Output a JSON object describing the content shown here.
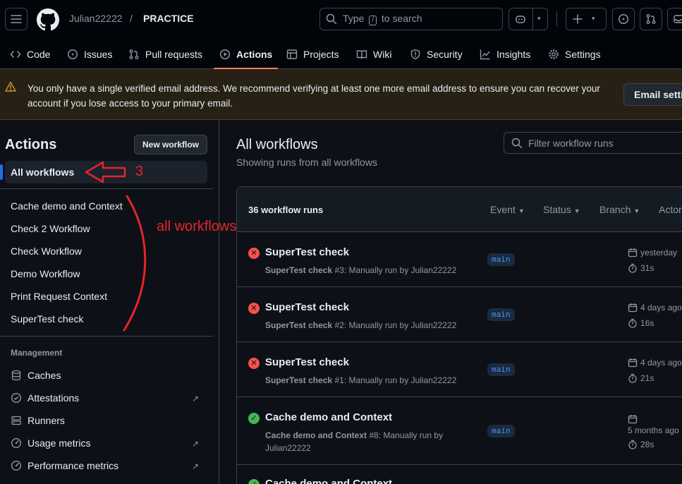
{
  "header": {
    "owner": "Julian22222",
    "separator": "/",
    "repo": "PRACTICE",
    "search_placeholder_before": "Type",
    "search_key": "/",
    "search_placeholder_after": "to search"
  },
  "tabs": [
    {
      "label": "Code",
      "icon": "code-icon"
    },
    {
      "label": "Issues",
      "icon": "issue-icon"
    },
    {
      "label": "Pull requests",
      "icon": "pull-request-icon"
    },
    {
      "label": "Actions",
      "icon": "play-icon",
      "active": true
    },
    {
      "label": "Projects",
      "icon": "table-icon"
    },
    {
      "label": "Wiki",
      "icon": "book-icon"
    },
    {
      "label": "Security",
      "icon": "shield-icon"
    },
    {
      "label": "Insights",
      "icon": "graph-icon"
    },
    {
      "label": "Settings",
      "icon": "gear-icon"
    }
  ],
  "banner": {
    "text": "You only have a single verified email address. We recommend verifying at least one more email address to ensure you can recover your account if you lose access to your primary email.",
    "button": "Email settings"
  },
  "sidebar": {
    "title": "Actions",
    "new_workflow": "New workflow",
    "active": "All workflows",
    "workflows": [
      "Cache demo and Context",
      "Check 2 Workflow",
      "Check Workflow",
      "Demo Workflow",
      "Print Request Context",
      "SuperTest check"
    ],
    "management_heading": "Management",
    "management": [
      {
        "label": "Caches",
        "icon": "database-icon"
      },
      {
        "label": "Attestations",
        "icon": "verified-icon",
        "external": true
      },
      {
        "label": "Runners",
        "icon": "server-icon"
      },
      {
        "label": "Usage metrics",
        "icon": "meter-icon",
        "external": true
      },
      {
        "label": "Performance metrics",
        "icon": "meter-icon",
        "external": true
      }
    ]
  },
  "main": {
    "title": "All workflows",
    "subtitle": "Showing runs from all workflows",
    "filter_placeholder": "Filter workflow runs",
    "runs_count": "36 workflow runs",
    "filters": [
      "Event",
      "Status",
      "Branch",
      "Actor"
    ],
    "runs": [
      {
        "status": "failure",
        "title": "SuperTest check",
        "workflow": "SuperTest check",
        "detail": " #3: Manually run by Julian22222",
        "branch": "main",
        "date": "yesterday",
        "duration": "31s"
      },
      {
        "status": "failure",
        "title": "SuperTest check",
        "workflow": "SuperTest check",
        "detail": " #2: Manually run by Julian22222",
        "branch": "main",
        "date": "4 days ago",
        "duration": "16s"
      },
      {
        "status": "failure",
        "title": "SuperTest check",
        "workflow": "SuperTest check",
        "detail": " #1: Manually run by Julian22222",
        "branch": "main",
        "date": "4 days ago",
        "duration": "21s"
      },
      {
        "status": "success",
        "title": "Cache demo and Context",
        "workflow": "Cache demo and Context",
        "detail": " #8: Manually run by",
        "detail2": "Julian22222",
        "branch": "main",
        "date": "5 months ago",
        "duration": "28s"
      },
      {
        "status": "success",
        "title": "Cache demo and Context"
      }
    ]
  },
  "annotations": {
    "label": "all workflows",
    "number": "3",
    "color": "#e5252a"
  }
}
